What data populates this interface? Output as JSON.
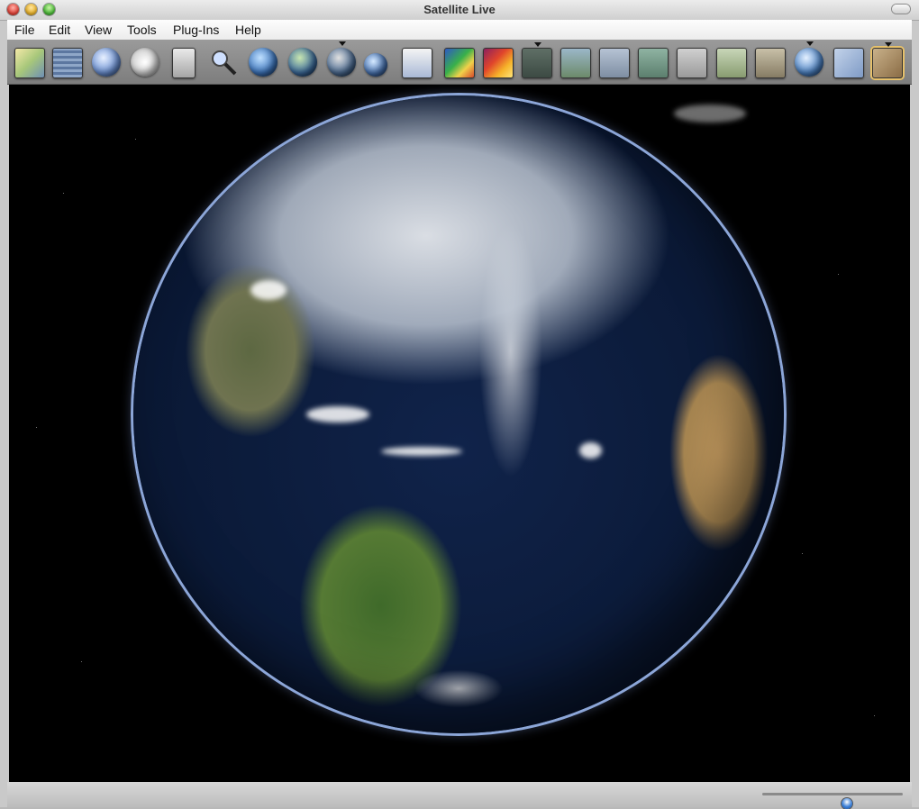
{
  "window": {
    "title": "Satellite Live"
  },
  "menu": {
    "items": [
      {
        "label": "File"
      },
      {
        "label": "Edit"
      },
      {
        "label": "View"
      },
      {
        "label": "Tools"
      },
      {
        "label": "Plug-Ins"
      },
      {
        "label": "Help"
      }
    ]
  },
  "toolbar": {
    "buttons": [
      {
        "icon": "layers-icon"
      },
      {
        "icon": "grid-icon"
      },
      {
        "icon": "globe-grid-icon"
      },
      {
        "icon": "clock-icon"
      },
      {
        "icon": "camera-icon"
      },
      {
        "icon": "magnifier-icon"
      },
      {
        "icon": "globe-view-1-icon"
      },
      {
        "icon": "globe-view-2-icon"
      },
      {
        "icon": "globe-view-3-icon",
        "dropdown": true
      },
      {
        "icon": "globe-view-4-icon"
      },
      {
        "icon": "map-view-1-icon"
      },
      {
        "icon": "map-view-2-icon"
      },
      {
        "icon": "heatmap-icon"
      },
      {
        "icon": "map-view-3-icon",
        "dropdown": true
      },
      {
        "icon": "map-view-4-icon"
      },
      {
        "icon": "map-view-5-icon"
      },
      {
        "icon": "map-view-6-icon"
      },
      {
        "icon": "map-view-7-icon"
      },
      {
        "icon": "map-view-8-icon"
      },
      {
        "icon": "map-view-9-icon"
      },
      {
        "icon": "globe-search-icon",
        "dropdown": true
      },
      {
        "icon": "map-view-10-icon"
      },
      {
        "icon": "map-view-11-icon",
        "dropdown": true
      }
    ]
  },
  "statusbar": {
    "zoom_level": 0.6
  }
}
